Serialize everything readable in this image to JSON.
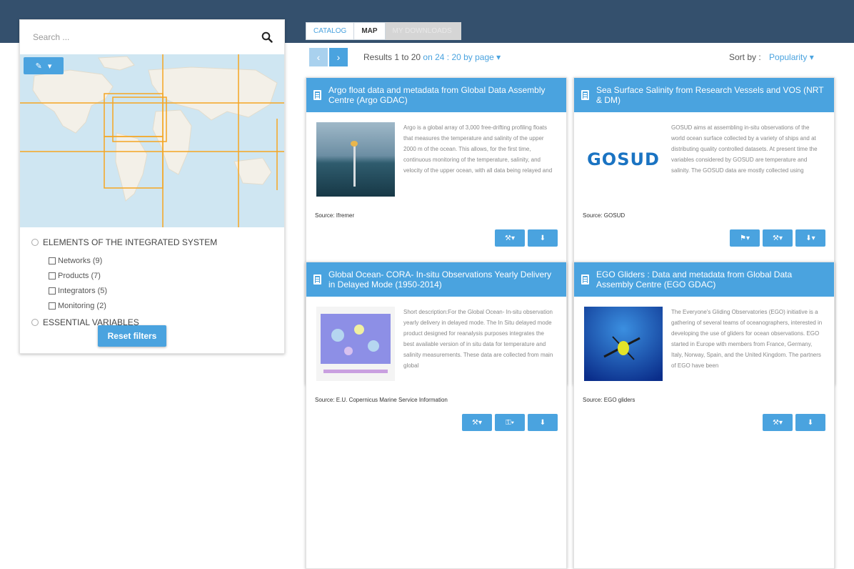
{
  "search": {
    "placeholder": "Search ..."
  },
  "filters": {
    "group1": "ELEMENTS OF THE INTEGRATED SYSTEM",
    "items": [
      "Networks (9)",
      "Products (7)",
      "Integrators (5)",
      "Monitoring (2)"
    ],
    "group2": "ESSENTIAL VARIABLES",
    "reset": "Reset filters"
  },
  "tabs": {
    "catalog": "CATALOG",
    "map": "MAP",
    "downloads": "MY DOWNLOADS"
  },
  "pager": {
    "prev": "‹",
    "next": "›"
  },
  "results": {
    "prefix": "Results 1 to 20",
    "middle": "on 24 :",
    "per_page": "20 by page ▾"
  },
  "sort": {
    "label": "Sort by :",
    "value": "Popularity ▾"
  },
  "cards": [
    {
      "title": "Argo float data and metadata from Global Data Assembly Centre (Argo GDAC)",
      "description": "Argo is a global array of 3,000 free-drifting profiling floats that measures the temperature and salinity of the upper 2000 m of the ocean. This allows, for the first time, continuous monitoring of the temperature, salinity, and velocity of the upper ocean, with all data being relayed and",
      "source": "Source: Ifremer"
    },
    {
      "title": "Sea Surface Salinity from Research Vessels and VOS (NRT & DM)",
      "description": "GOSUD aims at assembling in-situ observations of the world ocean surface collected by a variety of ships and at distributing quality controlled datasets. At present time the variables considered by GOSUD are temperature and salinity. The GOSUD data are mostly collected using",
      "source": "Source: GOSUD",
      "logo": "GOSUD"
    },
    {
      "title": "Global Ocean- CORA- In-situ Observations Yearly Delivery in Delayed Mode (1950-2014)",
      "description": "Short description:For the Global Ocean- In-situ observation yearly delivery in delayed mode. The In Situ delayed mode product designed for reanalysis purposes integrates the best available version of in situ data for temperature and salinity measurements. These data are collected from main global",
      "source": "Source: E.U. Copernicus Marine Service Information"
    },
    {
      "title": "EGO Gliders : Data and metadata from Global Data Assembly Centre (EGO GDAC)",
      "description": "The Everyone's Gliding Observatories (EGO) initiative is a gathering of several teams of oceanographers, interested in developing the use of gliders for ocean observations. EGO started in Europe with members from France, Germany, Italy, Norway, Spain, and the United Kingdom. The partners of EGO have been",
      "source": "Source: EGO gliders"
    }
  ],
  "colors": {
    "topbar": "#34506d",
    "accent": "#4aa3df",
    "map_water": "#cfe6f2",
    "grid": "#f5a623"
  }
}
